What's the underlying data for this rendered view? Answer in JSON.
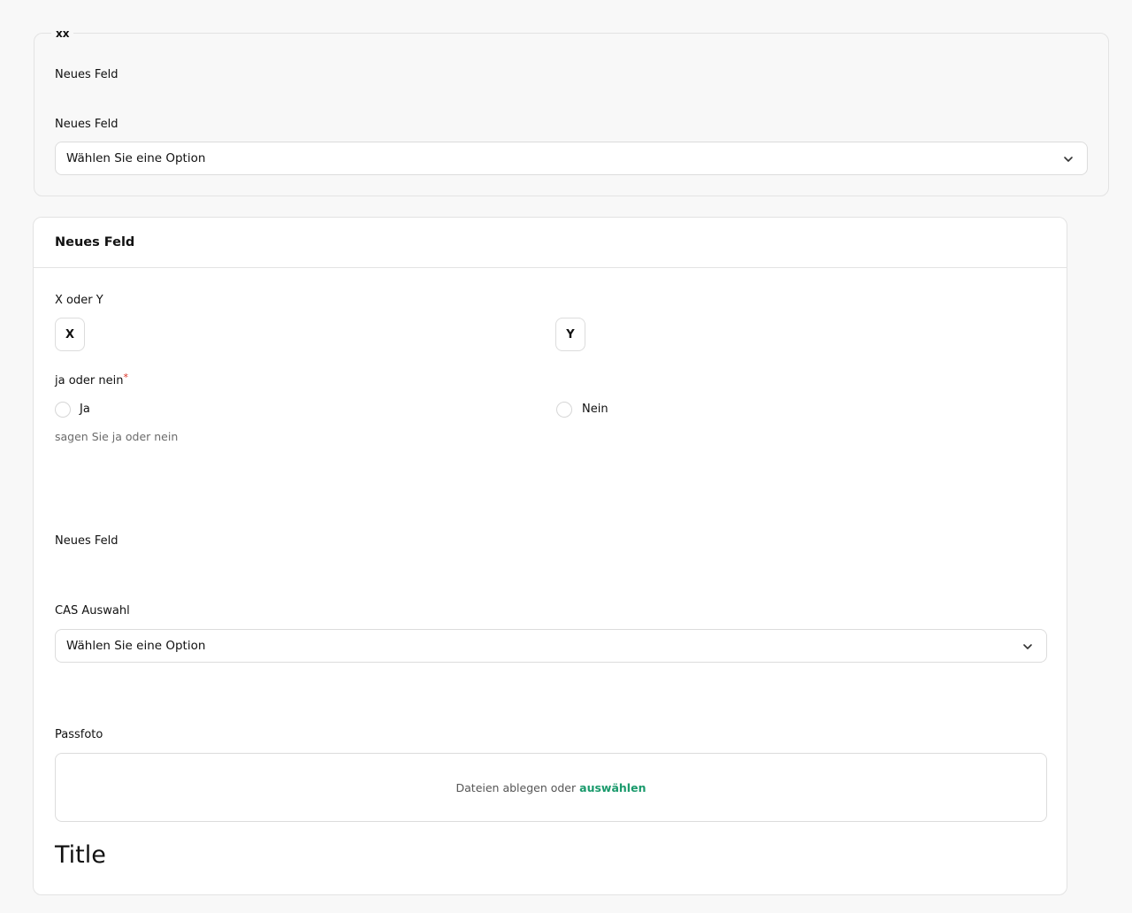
{
  "fieldset": {
    "legend": "xx",
    "field1_label": "Neues Feld",
    "field2_label": "Neues Feld",
    "select_value": "Wählen Sie eine Option"
  },
  "card": {
    "title": "Neues Feld",
    "xy": {
      "label": "X oder Y",
      "option_x": "X",
      "option_y": "Y"
    },
    "yes_no": {
      "label": "ja oder nein",
      "required_mark": "*",
      "option_yes": "Ja",
      "option_no": "Nein",
      "help": "sagen Sie ja oder nein"
    },
    "neues_feld_label": "Neues Feld",
    "cas": {
      "label": "CAS Auswahl",
      "select_value": "Wählen Sie eine Option"
    },
    "passfoto": {
      "label": "Passfoto",
      "drop_text": "Dateien ablegen oder",
      "drop_link": "auswählen"
    },
    "title_heading": "Title"
  },
  "icons": {
    "select_chevron": "chevron-down-icon"
  },
  "colors": {
    "accent": "#1a9a6c",
    "required": "#d92d20",
    "border": "#dcdcdc",
    "background": "#f8f8f8"
  }
}
